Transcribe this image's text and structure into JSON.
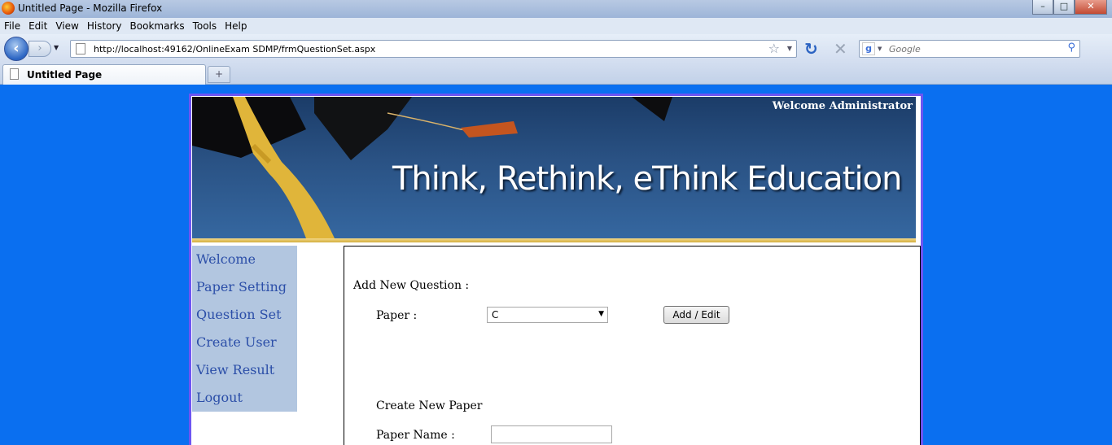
{
  "window": {
    "title": "Untitled Page - Mozilla Firefox"
  },
  "menu": [
    "File",
    "Edit",
    "View",
    "History",
    "Bookmarks",
    "Tools",
    "Help"
  ],
  "nav": {
    "url": "http://localhost:49162/OnlineExam SDMP/frmQuestionSet.aspx",
    "search_placeholder": "Google"
  },
  "tabs": [
    {
      "label": "Untitled Page"
    }
  ],
  "banner": {
    "welcome": "Welcome Administrator",
    "tagline": "Think, Rethink, eThink Education"
  },
  "sidebar": {
    "items": [
      "Welcome",
      "Paper Setting",
      "Question Set",
      "Create User",
      "View Result",
      "Logout"
    ]
  },
  "content": {
    "add_heading": "Add New Question :",
    "paper_label": "Paper :",
    "paper_selected": "C",
    "add_edit_button": "Add / Edit",
    "create_heading": "Create New Paper",
    "paper_name_label": "Paper Name :"
  },
  "colors": {
    "page_background": "#0a6ff0",
    "sidebar_background": "#b2c6e0",
    "link": "#2b4ea8"
  }
}
